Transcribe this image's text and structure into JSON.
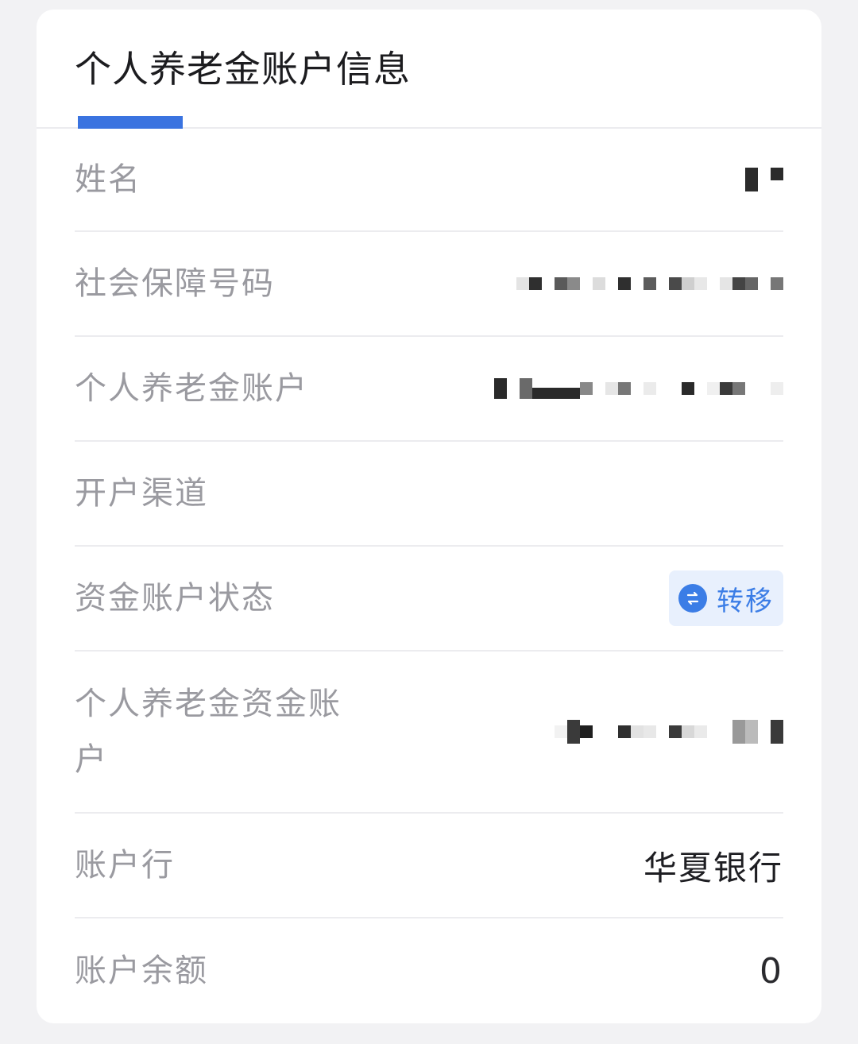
{
  "card": {
    "title": "个人养老金账户信息"
  },
  "rows": [
    {
      "label": "姓名",
      "value": ""
    },
    {
      "label": "社会保障号码",
      "value": ""
    },
    {
      "label": "个人养老金账户",
      "value": ""
    },
    {
      "label": "开户渠道",
      "value": ""
    },
    {
      "label": "资金账户状态",
      "status_label": "转移",
      "status_icon": "transfer-icon"
    },
    {
      "label": "个人养老金资金账户",
      "value": ""
    },
    {
      "label": "账户行",
      "value": "华夏银行"
    },
    {
      "label": "账户余额",
      "value": "0"
    }
  ],
  "colors": {
    "accent": "#3a73e0",
    "status_text": "#3b7de6",
    "status_bg": "#e8f0fd"
  }
}
